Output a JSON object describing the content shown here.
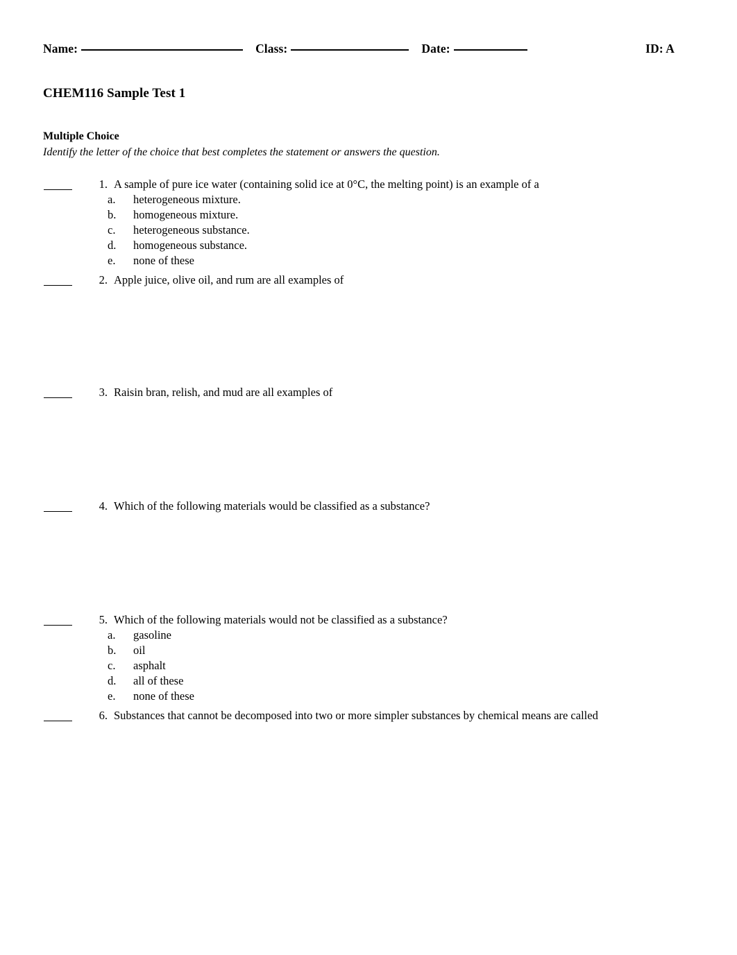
{
  "header": {
    "name_label": "Name:",
    "class_label": "Class:",
    "date_label": "Date:",
    "id_label": "ID: A"
  },
  "title": "CHEM116 Sample Test 1",
  "section": {
    "heading": "Multiple Choice",
    "instruction": "Identify the letter of the choice that best completes the statement or answers the question."
  },
  "questions": [
    {
      "number": "1.",
      "text": "A sample of pure ice water (containing solid ice at 0°C, the melting point) is an example of a",
      "choices": [
        {
          "letter": "a.",
          "text": "heterogeneous mixture."
        },
        {
          "letter": "b.",
          "text": "homogeneous mixture."
        },
        {
          "letter": "c.",
          "text": "heterogeneous substance."
        },
        {
          "letter": "d.",
          "text": "homogeneous substance."
        },
        {
          "letter": "e.",
          "text": "none of these"
        }
      ],
      "gap_after": 6
    },
    {
      "number": "2.",
      "text": "Apple juice, olive oil, and rum are all examples of",
      "choices": [],
      "gap_after": 140
    },
    {
      "number": "3.",
      "text": "Raisin bran, relish, and mud are all examples of",
      "choices": [],
      "gap_after": 142
    },
    {
      "number": "4.",
      "text": "Which of the following materials would be classified as a substance?",
      "choices": [],
      "gap_after": 142
    },
    {
      "number": "5.",
      "text": "Which of the following materials would not be classified as a substance?",
      "choices": [
        {
          "letter": "a.",
          "text": "gasoline"
        },
        {
          "letter": "b.",
          "text": "oil"
        },
        {
          "letter": "c.",
          "text": "asphalt"
        },
        {
          "letter": "d.",
          "text": "all of these"
        },
        {
          "letter": "e.",
          "text": "none of these"
        }
      ],
      "gap_after": 6
    },
    {
      "number": "6.",
      "text": "Substances that cannot be decomposed into two or more simpler substances by chemical means are called",
      "choices": [],
      "gap_after": 0
    }
  ]
}
